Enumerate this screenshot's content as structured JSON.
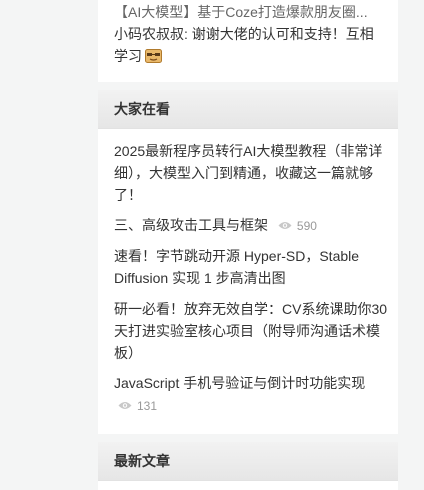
{
  "recent_comment": {
    "article_title": "【AI大模型】基于Coze打造爆款朋友圈...",
    "comment_text": "小码农叔叔: 谢谢大佬的认可和支持！互相学习"
  },
  "popular": {
    "title": "大家在看",
    "items": [
      {
        "title": "2025最新程序员转行AI大模型教程（非常详细），大模型入门到精通，收藏这一篇就够了！",
        "views": ""
      },
      {
        "title": "三、高级攻击工具与框架",
        "views": "590"
      },
      {
        "title": "速看！字节跳动开源 Hyper-SD，Stable Diffusion 实现 1 步高清出图",
        "views": ""
      },
      {
        "title": "研一必看！放弃无效自学：CV系统课助你30天打进实验室核心项目（附导师沟通话术模板）",
        "views": ""
      },
      {
        "title": "JavaScript 手机号验证与倒计时功能实现",
        "views": "131"
      }
    ]
  },
  "latest": {
    "title": "最新文章"
  },
  "icons": {
    "views": "eye-icon",
    "emoji": "emoji-icon"
  },
  "colors": {
    "page_bg": "#f4f5f5",
    "card_bg": "#ffffff",
    "muted": "#999999"
  }
}
